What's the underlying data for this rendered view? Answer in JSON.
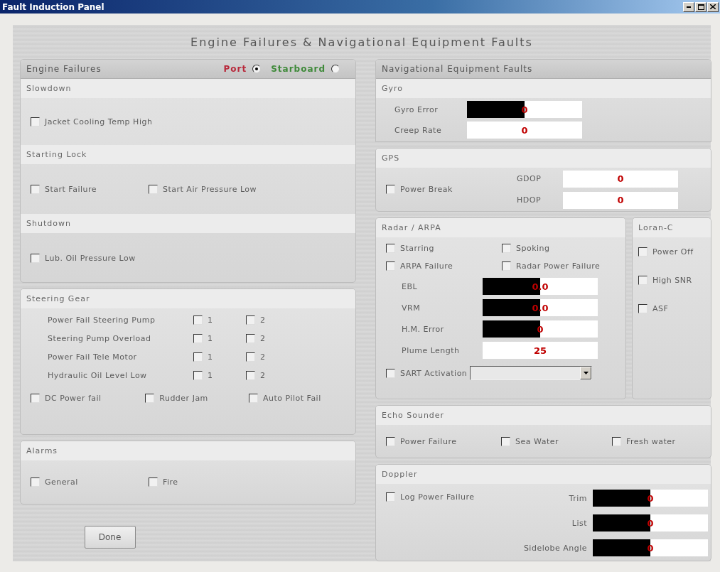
{
  "window": {
    "title": "Fault Induction Panel"
  },
  "heading": "Engine Failures & Navigational Equipment Faults",
  "engine_failures": {
    "title": "Engine Failures",
    "sides": [
      {
        "label": "Port",
        "color": "#b8283a",
        "selected": true
      },
      {
        "label": "Starboard",
        "color": "#3f8a3a",
        "selected": false
      }
    ],
    "groups": [
      {
        "title": "Slowdown",
        "items": [
          {
            "label": "Jacket Cooling Temp High",
            "checked": false
          }
        ]
      },
      {
        "title": "Starting Lock",
        "items": [
          {
            "label": "Start Failure",
            "checked": false
          },
          {
            "label": "Start Air Pressure Low",
            "checked": false
          }
        ]
      },
      {
        "title": "Shutdown",
        "items": [
          {
            "label": "Lub. Oil Pressure Low",
            "checked": false
          }
        ]
      }
    ]
  },
  "steering_gear": {
    "title": "Steering Gear",
    "rows": [
      {
        "label": "Power Fail Steering Pump",
        "options": [
          {
            "label": "1",
            "checked": false
          },
          {
            "label": "2",
            "checked": false
          }
        ]
      },
      {
        "label": "Steering Pump Overload",
        "options": [
          {
            "label": "1",
            "checked": false
          },
          {
            "label": "2",
            "checked": false
          }
        ]
      },
      {
        "label": "Power Fail Tele Motor",
        "options": [
          {
            "label": "1",
            "checked": false
          },
          {
            "label": "2",
            "checked": false
          }
        ]
      },
      {
        "label": "Hydraulic Oil Level Low",
        "options": [
          {
            "label": "1",
            "checked": false
          },
          {
            "label": "2",
            "checked": false
          }
        ]
      }
    ],
    "items": [
      {
        "label": "DC Power fail",
        "checked": false
      },
      {
        "label": "Rudder Jam",
        "checked": false
      },
      {
        "label": "Auto Pilot Fail",
        "checked": false
      }
    ]
  },
  "alarms": {
    "title": "Alarms",
    "items": [
      {
        "label": "General",
        "checked": false
      },
      {
        "label": "Fire",
        "checked": false
      }
    ]
  },
  "done_button": "Done",
  "navigation": {
    "title": "Navigational Equipment Faults",
    "gyro": {
      "title": "Gyro",
      "fields": [
        {
          "label": "Gyro Error",
          "value": "0",
          "level": 0.5
        },
        {
          "label": "Creep Rate",
          "value": "0"
        }
      ]
    },
    "gps": {
      "title": "GPS",
      "items": [
        {
          "label": "Power Break",
          "checked": false
        }
      ],
      "fields": [
        {
          "label": "GDOP",
          "value": "0"
        },
        {
          "label": "HDOP",
          "value": "0"
        }
      ]
    },
    "radar": {
      "title": "Radar / ARPA",
      "items": [
        {
          "label": "Starring",
          "checked": false
        },
        {
          "label": "Spoking",
          "checked": false
        },
        {
          "label": "ARPA Failure",
          "checked": false
        },
        {
          "label": "Radar Power Failure",
          "checked": false
        }
      ],
      "fields": [
        {
          "label": "EBL",
          "value": "0.0",
          "level": 0.5
        },
        {
          "label": "VRM",
          "value": "0.0",
          "level": 0.5
        },
        {
          "label": "H.M. Error",
          "value": "0",
          "level": 0.5
        },
        {
          "label": "Plume Length",
          "value": "25"
        }
      ],
      "sart": {
        "label": "SART Activation",
        "checked": false
      }
    },
    "loran": {
      "title": "Loran-C",
      "items": [
        {
          "label": "Power Off",
          "checked": false
        },
        {
          "label": "High SNR",
          "checked": false
        },
        {
          "label": "ASF",
          "checked": false
        }
      ]
    },
    "echo_sounder": {
      "title": "Echo Sounder",
      "items": [
        {
          "label": "Power Failure",
          "checked": false
        },
        {
          "label": "Sea Water",
          "checked": false
        },
        {
          "label": "Fresh water",
          "checked": false
        }
      ]
    },
    "doppler": {
      "title": "Doppler",
      "items": [
        {
          "label": "Log Power Failure",
          "checked": false
        }
      ],
      "fields": [
        {
          "label": "Trim",
          "value": "0",
          "level": 0.5
        },
        {
          "label": "List",
          "value": "0",
          "level": 0.5
        },
        {
          "label": "Sidelobe Angle",
          "value": "0",
          "level": 0.5
        }
      ]
    }
  }
}
